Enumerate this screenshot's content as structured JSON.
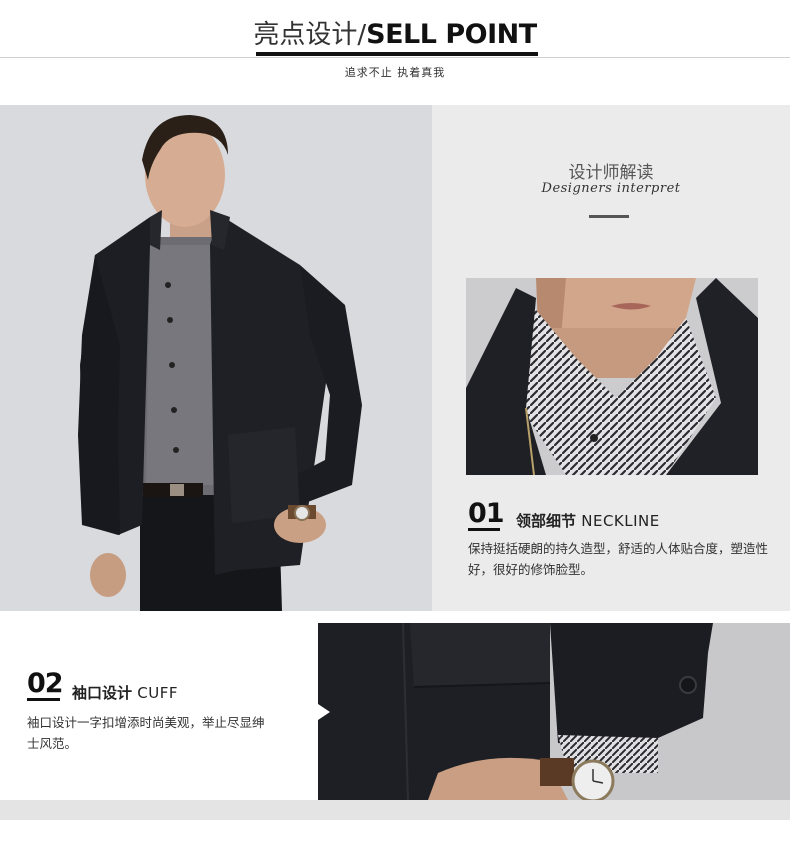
{
  "header": {
    "title_cn": "亮点设计",
    "title_sep": "/",
    "title_en": "SELL POINT",
    "subtitle": "追求不止 执着真我"
  },
  "designer": {
    "title_cn": "设计师解读",
    "title_en": "Designers interpret"
  },
  "sections": [
    {
      "number": "01",
      "title_cn": "领部细节",
      "title_en": "NECKLINE",
      "description": "保持挺括硬朗的持久造型，舒适的人体贴合度，塑造性好，很好的修饰脸型。"
    },
    {
      "number": "02",
      "title_cn": "袖口设计",
      "title_en": "CUFF",
      "description": "袖口设计一字扣增添时尚美观，举止尽显绅士风范。"
    }
  ],
  "colors": {
    "accent": "#111111",
    "panel_gray": "#ebebeb",
    "jacket": "#1c1d22"
  },
  "images": {
    "hero": "model-wearing-black-jacket",
    "neckline": "neckline-closeup",
    "cuff": "cuff-button-closeup"
  }
}
